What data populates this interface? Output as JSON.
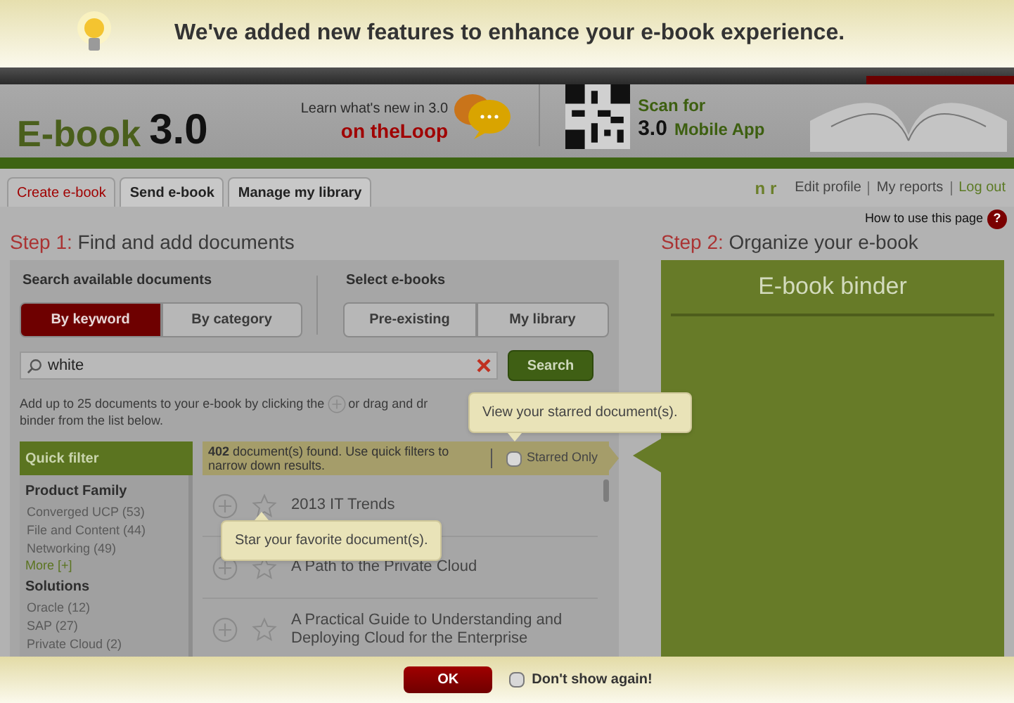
{
  "announcement": {
    "message": "We've added new features to enhance your e-book experience.",
    "button": "OK",
    "dont_show_again": {
      "label": "Don't show again!",
      "checked": false
    }
  },
  "header": {
    "title": "E-book",
    "version": "3.0",
    "promo_line1": "Learn what's new in 3.0",
    "promo_line2": "on theLoop",
    "scan_line1": "Scan for",
    "scan_version": "3.0",
    "scan_line2": "Mobile App"
  },
  "tabs": [
    {
      "label": "Create e-book",
      "selected": true
    },
    {
      "label": "Send e-book",
      "selected": false
    },
    {
      "label": "Manage my library",
      "selected": false
    }
  ],
  "user": {
    "initials": "n r",
    "links": [
      "Edit profile",
      "My reports",
      "Log out"
    ]
  },
  "help": {
    "label": "How to use this page",
    "icon": "?"
  },
  "step1": {
    "label": "Step 1:",
    "title": "Find and add documents"
  },
  "search": {
    "heading": "Search available documents",
    "modes": [
      {
        "label": "By keyword",
        "selected": true
      },
      {
        "label": "By category",
        "selected": false
      }
    ],
    "value": "white",
    "button": "Search"
  },
  "select_ebooks": {
    "heading": "Select e-books",
    "options": [
      "Pre-existing",
      "My library"
    ]
  },
  "instructions": {
    "before": "Add up to 25 documents to your e-book by clicking the",
    "after": "or drag and dr",
    "line2": "binder from the list below."
  },
  "quick_filter": {
    "title": "Quick filter",
    "groups": [
      {
        "title": "Product Family",
        "items": [
          "Converged UCP (53)",
          "File and Content (44)",
          "Networking (49)"
        ],
        "more": "More [+]"
      },
      {
        "title": "Solutions",
        "items": [
          "Oracle (12)",
          "SAP (27)",
          "Private Cloud (2)"
        ]
      }
    ]
  },
  "results": {
    "summary": "**402** document(s) found. Use quick filters to narrow down results.",
    "starred_only": {
      "label": "Starred Only",
      "checked": false
    },
    "documents": [
      {
        "title": "2013 IT Trends",
        "starred": false
      },
      {
        "title": "A Path to the Private Cloud",
        "starred": false
      },
      {
        "title": "A Practical Guide to Understanding and Deploying Cloud for the Enterprise",
        "starred": false
      }
    ]
  },
  "tooltips": {
    "starred": "View your starred document(s).",
    "star": "Star your favorite document(s)."
  },
  "step2": {
    "label": "Step 2:",
    "title": "Organize your e-book",
    "binder_title": "E-book binder"
  }
}
